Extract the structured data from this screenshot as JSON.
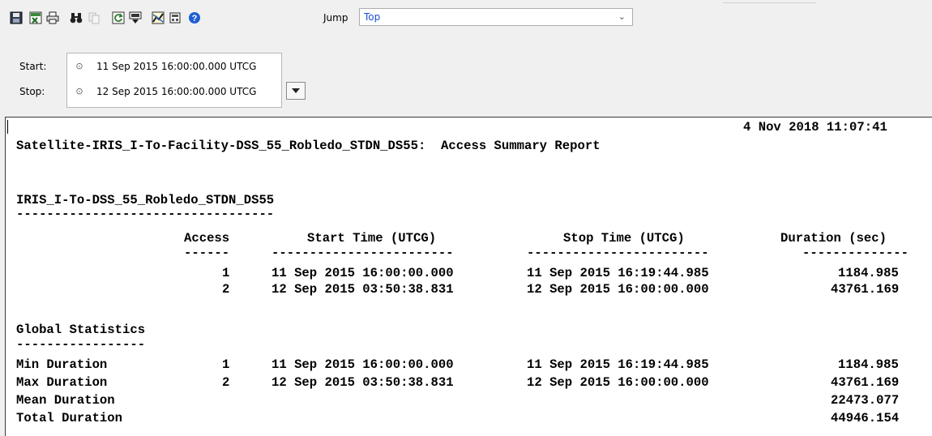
{
  "toolbar": {
    "buttons": [
      {
        "icon": "save-icon",
        "name": "save-button"
      },
      {
        "icon": "export-excel-icon",
        "name": "export-excel-button"
      },
      {
        "icon": "print-icon",
        "name": "print-button"
      },
      {
        "icon": "find-icon",
        "name": "find-button"
      },
      {
        "icon": "copy-icon",
        "name": "copy-button"
      },
      {
        "icon": "refresh-icon",
        "name": "refresh-button"
      },
      {
        "icon": "properties-icon",
        "name": "properties-button"
      },
      {
        "icon": "graph-icon",
        "name": "graph-button"
      },
      {
        "icon": "report-style-icon",
        "name": "report-style-button"
      },
      {
        "icon": "help-icon",
        "name": "help-button"
      }
    ],
    "jump_label": "Jump",
    "jump_value": "Top"
  },
  "times": {
    "start_label": "Start:",
    "start_value": "11 Sep 2015 16:00:00.000 UTCG",
    "stop_label": "Stop:",
    "stop_value": "12 Sep 2015 16:00:00.000 UTCG"
  },
  "report": {
    "date": "4 Nov 2018 11:07:41",
    "title": "Satellite-IRIS_I-To-Facility-DSS_55_Robledo_STDN_DS55:  Access Summary Report",
    "section_title": "IRIS_I-To-DSS_55_Robledo_STDN_DS55",
    "section_underline": "----------------------------------",
    "columns": {
      "access": "Access",
      "start": "Start Time (UTCG)",
      "stop": "Stop Time (UTCG)",
      "duration": "Duration (sec)"
    },
    "column_underlines": {
      "access": "------",
      "start": "------------------------",
      "stop": "------------------------",
      "duration": "--------------"
    },
    "rows": [
      {
        "access": "1",
        "start": "11 Sep 2015 16:00:00.000",
        "stop": "11 Sep 2015 16:19:44.985",
        "duration": "1184.985"
      },
      {
        "access": "2",
        "start": "12 Sep 2015 03:50:38.831",
        "stop": "12 Sep 2015 16:00:00.000",
        "duration": "43761.169"
      }
    ],
    "stats_title": "Global Statistics",
    "stats_underline": "-----------------",
    "stats": [
      {
        "label": "Min Duration",
        "access": "1",
        "start": "11 Sep 2015 16:00:00.000",
        "stop": "11 Sep 2015 16:19:44.985",
        "duration": "1184.985"
      },
      {
        "label": "Max Duration",
        "access": "2",
        "start": "12 Sep 2015 03:50:38.831",
        "stop": "12 Sep 2015 16:00:00.000",
        "duration": "43761.169"
      },
      {
        "label": "Mean Duration",
        "access": "",
        "start": "",
        "stop": "",
        "duration": "22473.077"
      },
      {
        "label": "Total Duration",
        "access": "",
        "start": "",
        "stop": "",
        "duration": "44946.154"
      }
    ]
  }
}
